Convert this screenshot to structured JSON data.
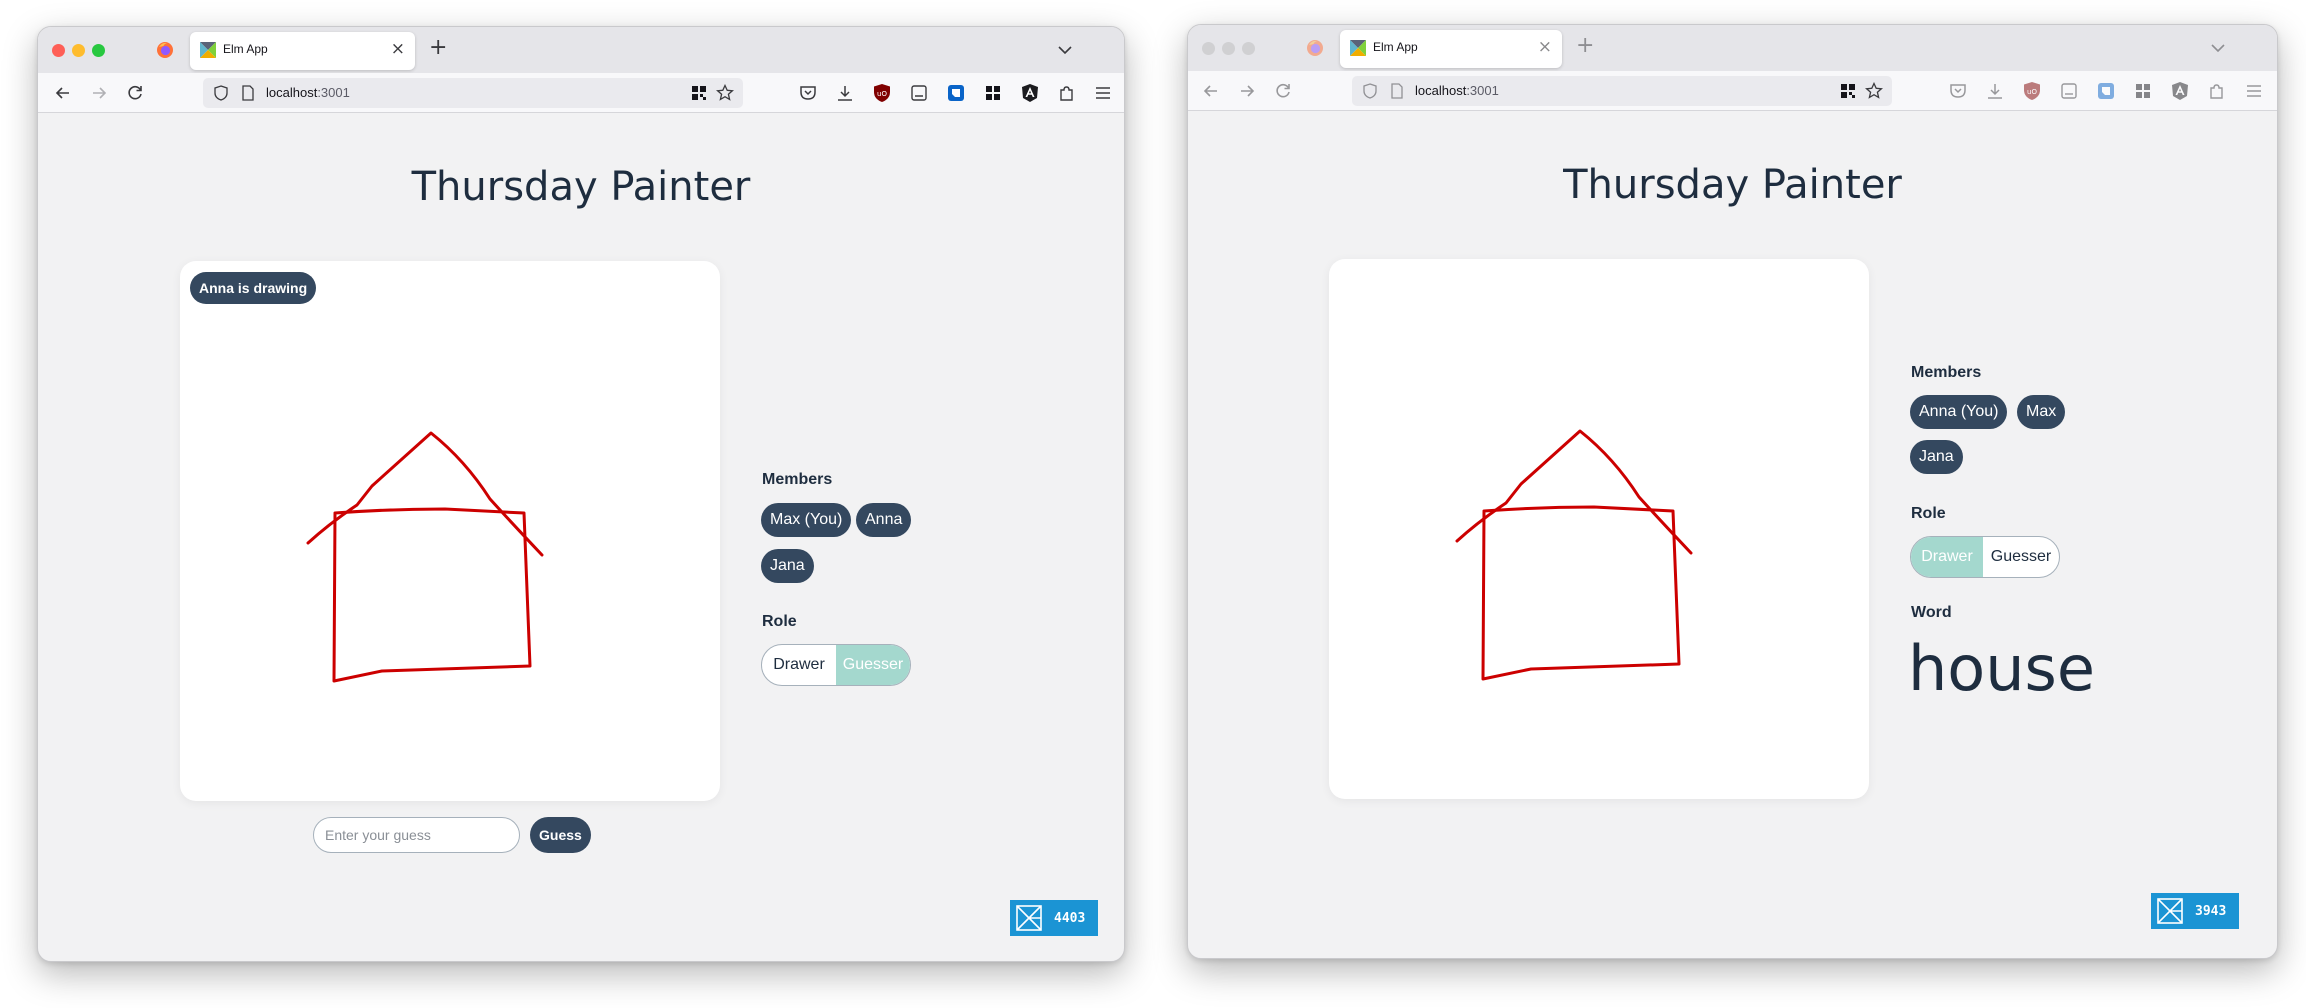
{
  "windows": [
    {
      "tab": {
        "title": "Elm App"
      },
      "url": {
        "host": "localhost",
        "path": ":3001"
      },
      "app": {
        "title": "Thursday Painter",
        "drawing_status": "Anna is drawing",
        "members_label": "Members",
        "members": [
          "Max (You)",
          "Anna",
          "Jana"
        ],
        "role_label": "Role",
        "roles": [
          "Drawer",
          "Guesser"
        ],
        "selected_role": "Guesser",
        "guess": {
          "placeholder": "Enter your guess",
          "button_label": "Guess"
        },
        "elm_port": "4403"
      }
    },
    {
      "tab": {
        "title": "Elm App"
      },
      "url": {
        "host": "localhost",
        "path": ":3001"
      },
      "app": {
        "title": "Thursday Painter",
        "members_label": "Members",
        "members": [
          "Anna (You)",
          "Max",
          "Jana"
        ],
        "role_label": "Role",
        "roles": [
          "Drawer",
          "Guesser"
        ],
        "selected_role": "Drawer",
        "word_label": "Word",
        "word": "house",
        "elm_port": "3943"
      }
    }
  ],
  "colors": {
    "accent_dark": "#34485f",
    "role_active": "#a4d8ce",
    "stroke": "#cc0000",
    "elm_blue": "#1b94d4"
  },
  "icons": {
    "nav": [
      "back-arrow-icon",
      "forward-arrow-icon",
      "reload-icon"
    ],
    "toolbar": [
      "pocket-icon",
      "download-icon",
      "ublock-icon",
      "reader-icon",
      "extension-blue-icon",
      "grid-apps-icon",
      "angular-icon",
      "extensions-puzzle-icon",
      "hamburger-menu-icon"
    ]
  }
}
